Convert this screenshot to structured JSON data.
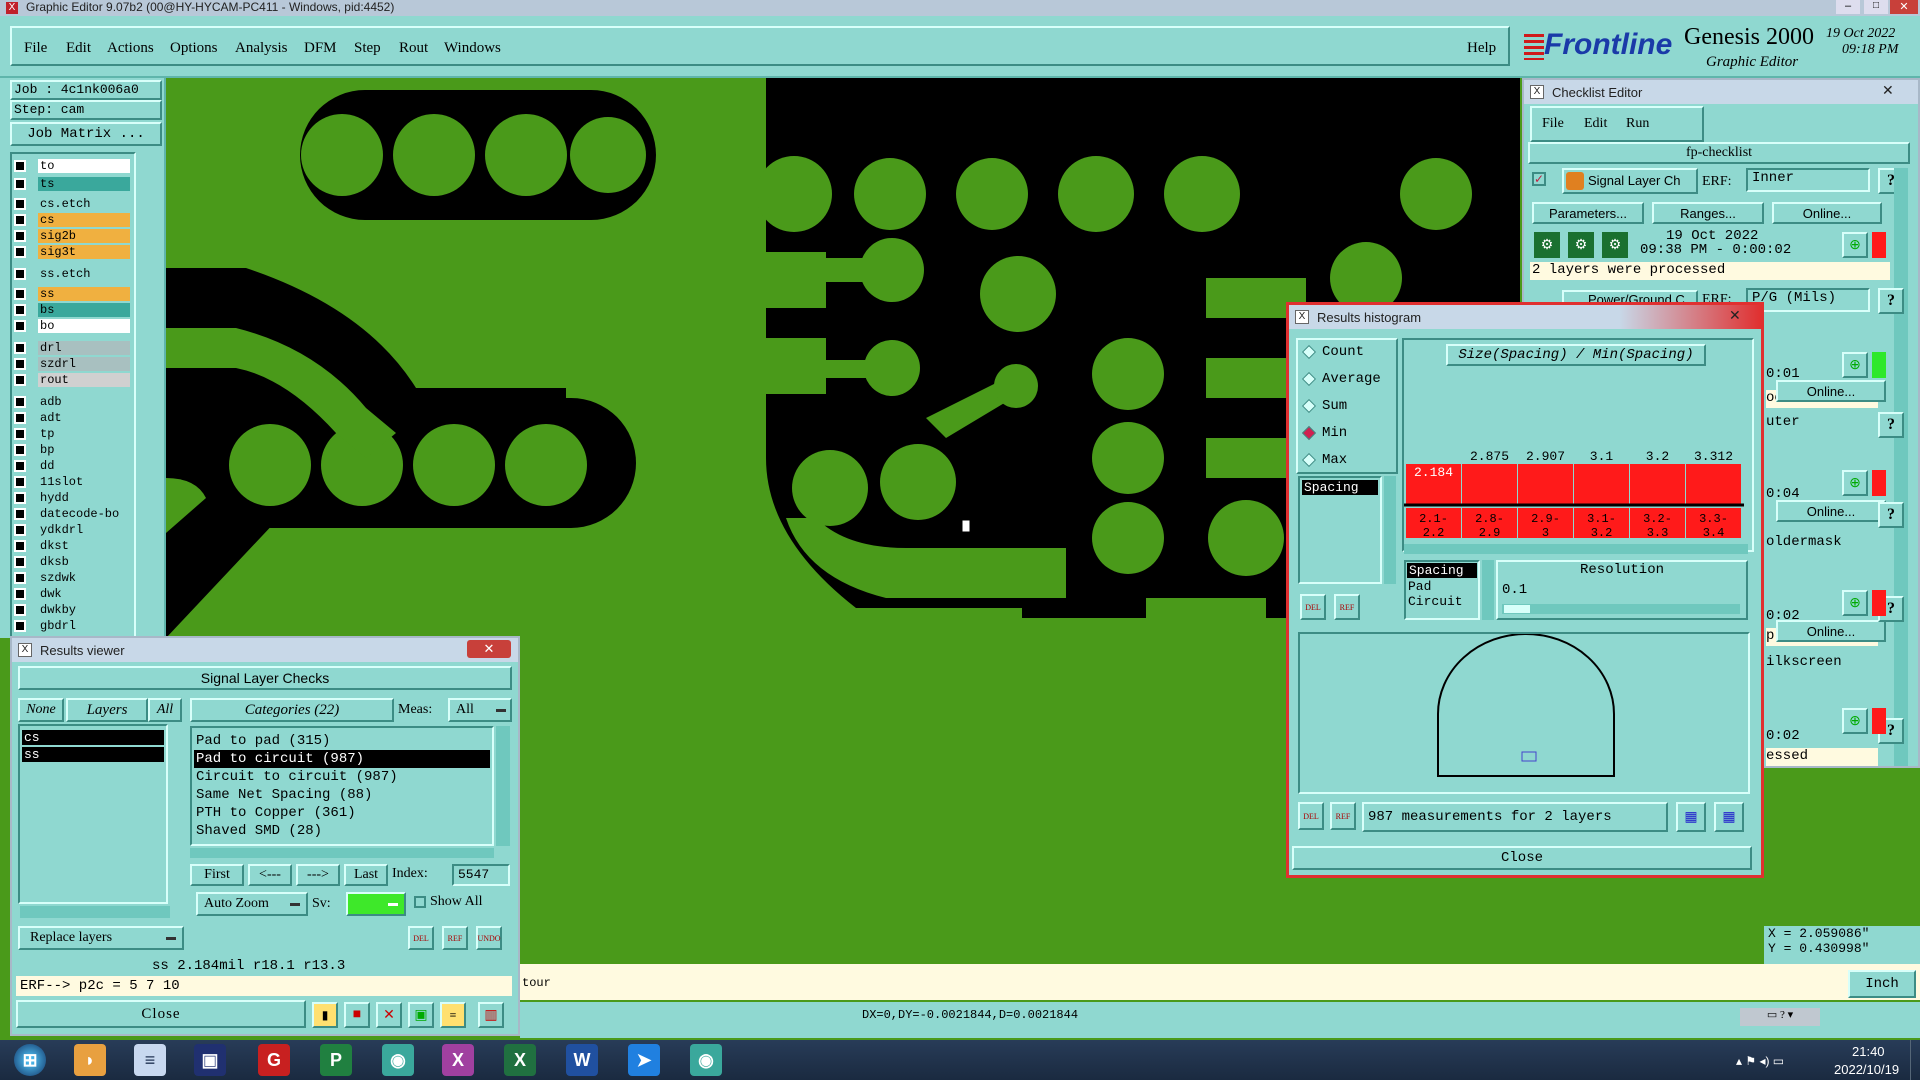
{
  "title_bar": {
    "text": "Graphic Editor 9.07b2 (00@HY-HYCAM-PC411 - Windows, pid:4452)"
  },
  "menu": {
    "items": [
      "File",
      "Edit",
      "Actions",
      "Options",
      "Analysis",
      "DFM",
      "Step",
      "Rout",
      "Windows"
    ],
    "help": "Help"
  },
  "brand": {
    "logo": "Frontline",
    "product": "Genesis 2000",
    "subtitle": "Graphic Editor",
    "date": "19 Oct 2022",
    "time": "09:18 PM"
  },
  "job": {
    "job_line": "Job : 4c1nk006a0",
    "step_line": "Step: cam",
    "matrix_button": "Job Matrix ..."
  },
  "layers": [
    {
      "name": "to",
      "color": "#ffffff"
    },
    {
      "name": "ts",
      "color": "#3aa89c"
    },
    {
      "name": "cs.etch",
      "color": "#8fd8d0"
    },
    {
      "name": "cs",
      "color": "#f0b040"
    },
    {
      "name": "sig2b",
      "color": "#f0b040"
    },
    {
      "name": "sig3t",
      "color": "#f0b040"
    },
    {
      "name": "ss.etch",
      "color": "#8fd8d0"
    },
    {
      "name": "ss",
      "color": "#f0b040"
    },
    {
      "name": "bs",
      "color": "#3aa89c"
    },
    {
      "name": "bo",
      "color": "#ffffff"
    },
    {
      "name": "drl",
      "color": "#a8c0c0"
    },
    {
      "name": "szdrl",
      "color": "#a8c0c0"
    },
    {
      "name": "rout",
      "color": "#d0d0d0"
    },
    {
      "name": "adb",
      "color": "#8fd8d0"
    },
    {
      "name": "adt",
      "color": "#8fd8d0"
    },
    {
      "name": "tp",
      "color": "#8fd8d0"
    },
    {
      "name": "bp",
      "color": "#8fd8d0"
    },
    {
      "name": "dd",
      "color": "#8fd8d0"
    },
    {
      "name": "11slot",
      "color": "#8fd8d0"
    },
    {
      "name": "hydd",
      "color": "#8fd8d0"
    },
    {
      "name": "datecode-bo",
      "color": "#8fd8d0"
    },
    {
      "name": "ydkdrl",
      "color": "#8fd8d0"
    },
    {
      "name": "dkst",
      "color": "#8fd8d0"
    },
    {
      "name": "dksb",
      "color": "#8fd8d0"
    },
    {
      "name": "szdwk",
      "color": "#8fd8d0"
    },
    {
      "name": "dwk",
      "color": "#8fd8d0"
    },
    {
      "name": "dwkby",
      "color": "#8fd8d0"
    },
    {
      "name": "gbdrl",
      "color": "#8fd8d0"
    }
  ],
  "results_viewer": {
    "title": "Results viewer",
    "header": "Signal Layer Checks",
    "none_btn": "None",
    "layers_btn": "Layers",
    "all_btn": "All",
    "categories_label": "Categories (22)",
    "meas_label": "Meas:",
    "meas_value": "All",
    "layer_list": [
      "cs",
      "ss"
    ],
    "categories": [
      "Pad to pad (315)",
      "Pad to circuit (987)",
      "Circuit to circuit (987)",
      "Same Net Spacing (88)",
      "PTH to Copper (361)",
      "Shaved SMD (28)"
    ],
    "selected_category": 1,
    "first": "First",
    "prev": "<---",
    "next": "--->",
    "last": "Last",
    "index_label": "Index:",
    "index_value": "5547",
    "auto_zoom": "Auto Zoom",
    "sv_label": "Sv:",
    "show_all": "Show All",
    "replace_layers": "Replace layers",
    "status": "ss 2.184mil  r18.1  r13.3",
    "erf_line": "ERF--> p2c = 5 7 10",
    "close": "Close"
  },
  "checklist": {
    "title": "Checklist Editor",
    "menu": [
      "File",
      "Edit",
      "Run"
    ],
    "name": "fp-checklist",
    "row1": {
      "label": "Signal Layer Ch",
      "erf": "ERF:",
      "erf_value": "Inner"
    },
    "buttons": {
      "params": "Parameters...",
      "ranges": "Ranges...",
      "online": "Online..."
    },
    "date": "19 Oct 2022",
    "time": "09:38 PM - 0:00:02",
    "processed": "2 layers were processed",
    "row2": {
      "label": "Power/Ground C",
      "erf": "ERF:",
      "erf_value": "P/G (Mils)"
    },
    "partial": [
      "0:01",
      "ocessed",
      "uter",
      "0:04",
      "oldermask",
      "0:02",
      "processed",
      "ilkscreen",
      "0:02",
      "essed"
    ]
  },
  "histogram": {
    "title": "Results histogram",
    "modes": [
      "Count",
      "Average",
      "Sum",
      "Min",
      "Max"
    ],
    "selected_mode": "Min",
    "chart_title": "Size(Spacing) / Min(Spacing)",
    "list1": [
      "Spacing"
    ],
    "list2": [
      "Spacing",
      "Pad",
      "Circuit"
    ],
    "resolution_label": "Resolution",
    "resolution_value": "0.1",
    "measurements": "987 measurements for 2 layers",
    "close": "Close",
    "del": "DEL",
    "ref": "REF"
  },
  "chart_data": {
    "type": "bar",
    "title": "Size(Spacing) / Min(Spacing)",
    "categories": [
      "2.1-2.2",
      "2.8-2.9",
      "2.9-3",
      "3.1-3.2",
      "3.2-3.3",
      "3.3-3.4"
    ],
    "values": [
      2.184,
      2.875,
      2.907,
      3.1,
      3.2,
      3.312
    ],
    "value_labels": [
      "2.184",
      "2.875",
      "2.907",
      "3.1",
      "3.2",
      "3.312"
    ],
    "bar_color": "#ff1a1a",
    "highlight_color": "#ff1a1a"
  },
  "coords": {
    "x": "X = 2.059086\"",
    "y": "Y = 0.430998\""
  },
  "status_bar": {
    "left": "tour",
    "units": "Inch",
    "measure": "DX=0,DY=-0.0021844,D=0.0021844"
  },
  "taskbar": {
    "time": "21:40",
    "date": "2022/10/19"
  }
}
